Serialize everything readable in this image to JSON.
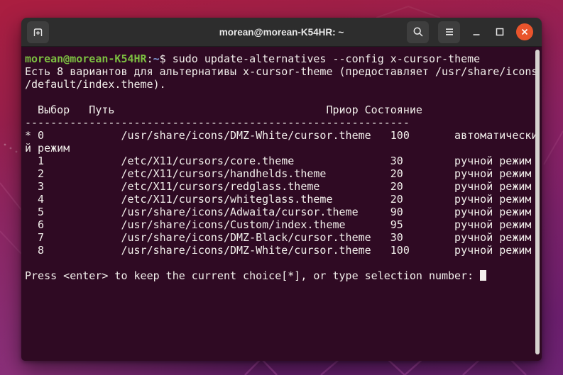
{
  "window": {
    "title": "morean@morean-K54HR: ~"
  },
  "terminal": {
    "prompt_user_host": "morean@morean-K54HR",
    "prompt_separator": ":",
    "prompt_path": "~",
    "prompt_suffix": "$ ",
    "command": "sudo update-alternatives --config x-cursor-theme",
    "lines": [
      "Есть 8 вариантов для альтернативы x-cursor-theme (предоставляет /usr/share/icons",
      "/default/index.theme).",
      "",
      "  Выбор   Путь                                 Приор Состояние",
      "------------------------------------------------------------",
      "* 0            /usr/share/icons/DMZ-White/cursor.theme   100       автоматически",
      "й режим",
      "  1            /etc/X11/cursors/core.theme               30        ручной режим",
      "  2            /etc/X11/cursors/handhelds.theme          20        ручной режим",
      "  3            /etc/X11/cursors/redglass.theme           20        ручной режим",
      "  4            /etc/X11/cursors/whiteglass.theme         20        ручной режим",
      "  5            /usr/share/icons/Adwaita/cursor.theme     90        ручной режим",
      "  6            /usr/share/icons/Custom/index.theme       95        ручной режим",
      "  7            /usr/share/icons/DMZ-Black/cursor.theme   30        ручной режим",
      "  8            /usr/share/icons/DMZ-White/cursor.theme   100       ручной режим",
      ""
    ],
    "press_line": "Press <enter> to keep the current choice[*], or type selection number: "
  },
  "table": {
    "headers": [
      "Выбор",
      "Путь",
      "Приор",
      "Состояние"
    ],
    "rows": [
      {
        "selected": "*",
        "choice": "0",
        "path": "/usr/share/icons/DMZ-White/cursor.theme",
        "priority": "100",
        "status": "автоматический режим"
      },
      {
        "selected": "",
        "choice": "1",
        "path": "/etc/X11/cursors/core.theme",
        "priority": "30",
        "status": "ручной режим"
      },
      {
        "selected": "",
        "choice": "2",
        "path": "/etc/X11/cursors/handhelds.theme",
        "priority": "20",
        "status": "ручной режим"
      },
      {
        "selected": "",
        "choice": "3",
        "path": "/etc/X11/cursors/redglass.theme",
        "priority": "20",
        "status": "ручной режим"
      },
      {
        "selected": "",
        "choice": "4",
        "path": "/etc/X11/cursors/whiteglass.theme",
        "priority": "20",
        "status": "ручной режим"
      },
      {
        "selected": "",
        "choice": "5",
        "path": "/usr/share/icons/Adwaita/cursor.theme",
        "priority": "90",
        "status": "ручной режим"
      },
      {
        "selected": "",
        "choice": "6",
        "path": "/usr/share/icons/Custom/index.theme",
        "priority": "95",
        "status": "ручной режим"
      },
      {
        "selected": "",
        "choice": "7",
        "path": "/usr/share/icons/DMZ-Black/cursor.theme",
        "priority": "30",
        "status": "ручной режим"
      },
      {
        "selected": "",
        "choice": "8",
        "path": "/usr/share/icons/DMZ-White/cursor.theme",
        "priority": "100",
        "status": "ручной режим"
      }
    ]
  },
  "icons": {
    "new_tab": "new-tab-icon",
    "search": "search-icon",
    "menu": "hamburger-menu-icon",
    "minimize": "minimize-icon",
    "maximize": "maximize-icon",
    "close": "close-icon"
  },
  "colors": {
    "titlebar_bg": "#2D2D2D",
    "titlebar_button_bg": "#3E3E3E",
    "close_button": "#E9542C",
    "terminal_bg": "#2F0A23",
    "terminal_fg": "#F2EFEB",
    "prompt_green": "#7CBE41",
    "path_blue": "#819AD6",
    "scrollbar": "#D6D3CF"
  }
}
